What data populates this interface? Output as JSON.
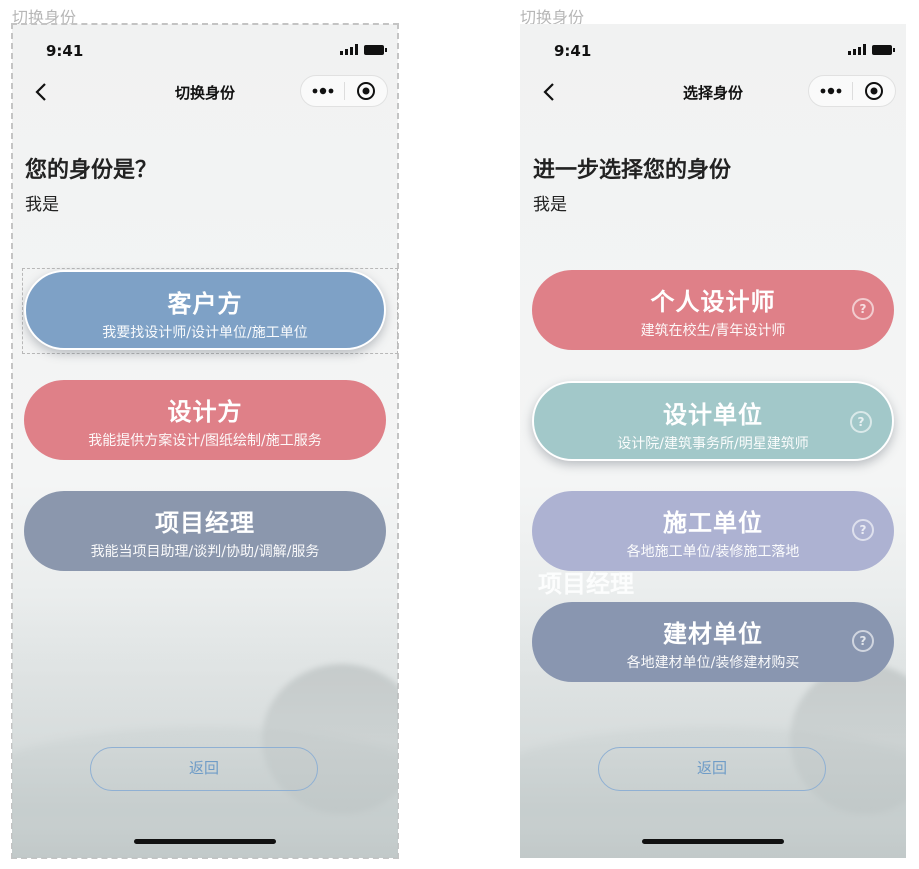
{
  "left": {
    "caption": "切换身份",
    "time": "9:41",
    "nav_title": "切换身份",
    "heading": "您的身份是？",
    "subheading": "我是",
    "options": [
      {
        "title": "客户方",
        "subtitle": "我要找设计师/设计单位/施工单位",
        "color": "#7ea1c6",
        "selected": true
      },
      {
        "title": "设计方",
        "subtitle": "我能提供方案设计/图纸绘制/施工服务",
        "color": "#df8088"
      },
      {
        "title": "项目经理",
        "subtitle": "我能当项目助理/谈判/协助/调解/服务",
        "color": "#8b97ad"
      }
    ],
    "back_label": "返回"
  },
  "right": {
    "caption": "切换身份",
    "time": "9:41",
    "nav_title": "选择身份",
    "heading": "进一步选择您的身份",
    "subheading": "我是",
    "options": [
      {
        "title": "个人设计师",
        "subtitle": "建筑在校生/青年设计师",
        "color": "#df8088",
        "help": "?"
      },
      {
        "title": "设计单位",
        "subtitle": "设计院/建筑事务所/明星建筑师",
        "color": "#a2c8c9",
        "help": "?",
        "selected": true
      },
      {
        "title": "施工单位",
        "subtitle": "各地施工单位/装修施工落地",
        "color": "#adb2d2",
        "help": "?"
      },
      {
        "title": "建材单位",
        "subtitle": "各地建材单位/装修建材购买",
        "color": "#8996b0",
        "help": "?"
      }
    ],
    "ghost_text": "项目经理",
    "back_label": "返回"
  },
  "icons": {
    "back": "chevron-left-icon",
    "more": "more-dots-icon",
    "close": "target-icon",
    "signal": "signal-icon",
    "battery": "battery-icon",
    "help": "question-circle-icon"
  }
}
